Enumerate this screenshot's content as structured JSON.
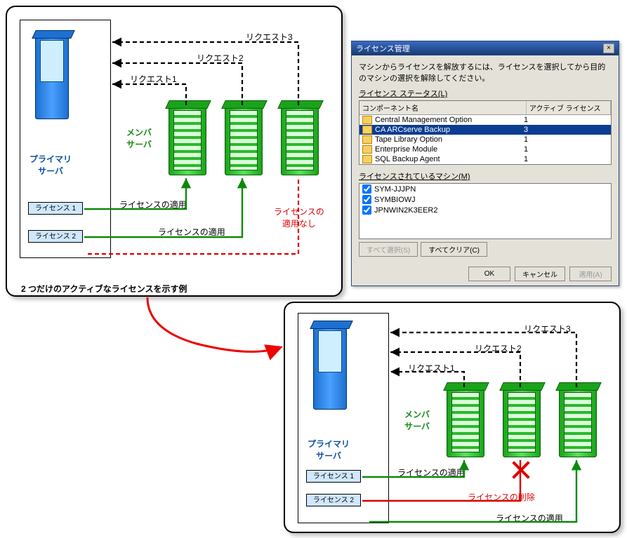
{
  "top_panel": {
    "primary_label": "プライマリ\nサーバ",
    "member_label": "メンバ\nサーバ",
    "request1": "リクエスト1",
    "request2": "リクエスト2",
    "request3": "リクエスト3",
    "license1": "ライセンス 1",
    "license2": "ライセンス 2",
    "apply1": "ライセンスの適用",
    "apply2": "ライセンスの適用",
    "no_apply": "ライセンスの\n適用なし",
    "caption": "2 つだけのアクティブなライセンスを示す例"
  },
  "bottom_panel": {
    "primary_label": "プライマリ\nサーバ",
    "member_label": "メンバ\nサーバ",
    "request1": "リクエスト1",
    "request2": "リクエスト2",
    "request3": "リクエスト3",
    "license1": "ライセンス 1",
    "license2": "ライセンス 2",
    "apply1": "ライセンスの適用",
    "delete_label": "ライセンスの削除",
    "apply2": "ライセンスの適用"
  },
  "dialog": {
    "title": "ライセンス管理",
    "instruction": "マシンからライセンスを解放するには、ライセンスを選択してから目的のマシンの選択を解除してください。",
    "status_label": "ライセンス ステータス(L)",
    "col_component": "コンポーネント名",
    "col_active": "アクティブ ライセンス",
    "rows": [
      {
        "name": "Central Management Option",
        "count": "1"
      },
      {
        "name": "CA ARCserve Backup",
        "count": "3"
      },
      {
        "name": "Tape Library Option",
        "count": "1"
      },
      {
        "name": "Enterprise Module",
        "count": "1"
      },
      {
        "name": "SQL Backup Agent",
        "count": "1"
      }
    ],
    "machines_label": "ライセンスされているマシン(M)",
    "machines": [
      "SYM-JJJPN",
      "SYMBIOWJ",
      "JPNWIN2K3EER2"
    ],
    "btn_select_all": "すべて選択(S)",
    "btn_clear_all": "すべてクリア(C)",
    "btn_ok": "OK",
    "btn_cancel": "キャンセル",
    "btn_apply": "適用(A)"
  }
}
